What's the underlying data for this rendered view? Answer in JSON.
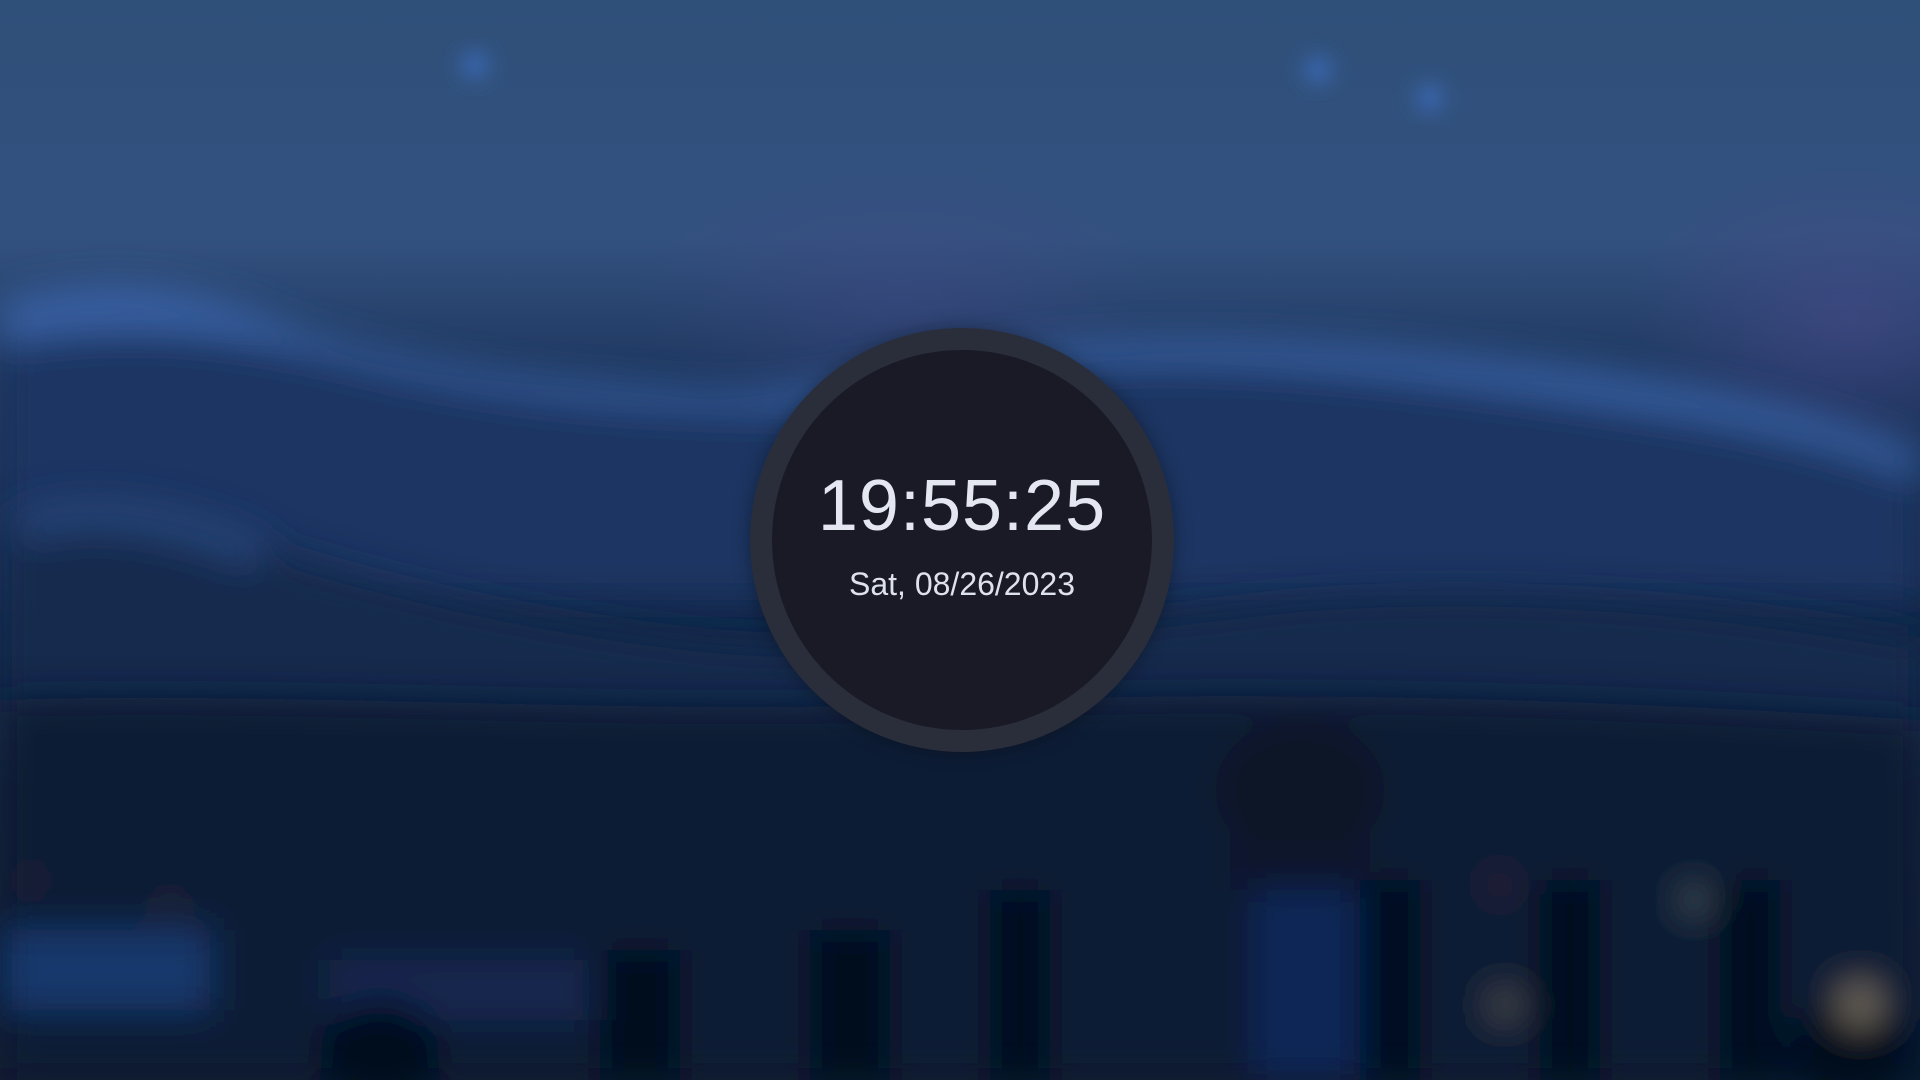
{
  "clock": {
    "time": "19:55:25",
    "date": "Sat, 08/26/2023"
  },
  "colors": {
    "sky_top": "#2f5079",
    "mountains": "#1c355c",
    "foreground": "#0a182e",
    "clock_ring": "#2a2e3b",
    "clock_face": "#191a26",
    "clock_text": "#e4e6f0"
  }
}
